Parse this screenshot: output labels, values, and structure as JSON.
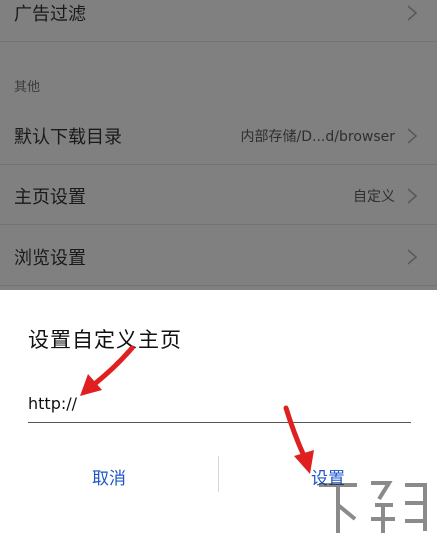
{
  "settings": {
    "rows": [
      {
        "title": "广告过滤",
        "value": ""
      },
      {
        "title": "默认下载目录",
        "value": "内部存储/D...d/browser"
      },
      {
        "title": "主页设置",
        "value": "自定义"
      },
      {
        "title": "浏览设置",
        "value": ""
      }
    ],
    "section_label": "其他"
  },
  "dialog": {
    "title": "设置自定义主页",
    "url_value": "http://",
    "cancel_label": "取消",
    "set_label": "设置"
  },
  "colors": {
    "accent": "#1c55c6",
    "overlay": "#808080",
    "annotation_arrow": "#e02020"
  },
  "watermark": "下载"
}
